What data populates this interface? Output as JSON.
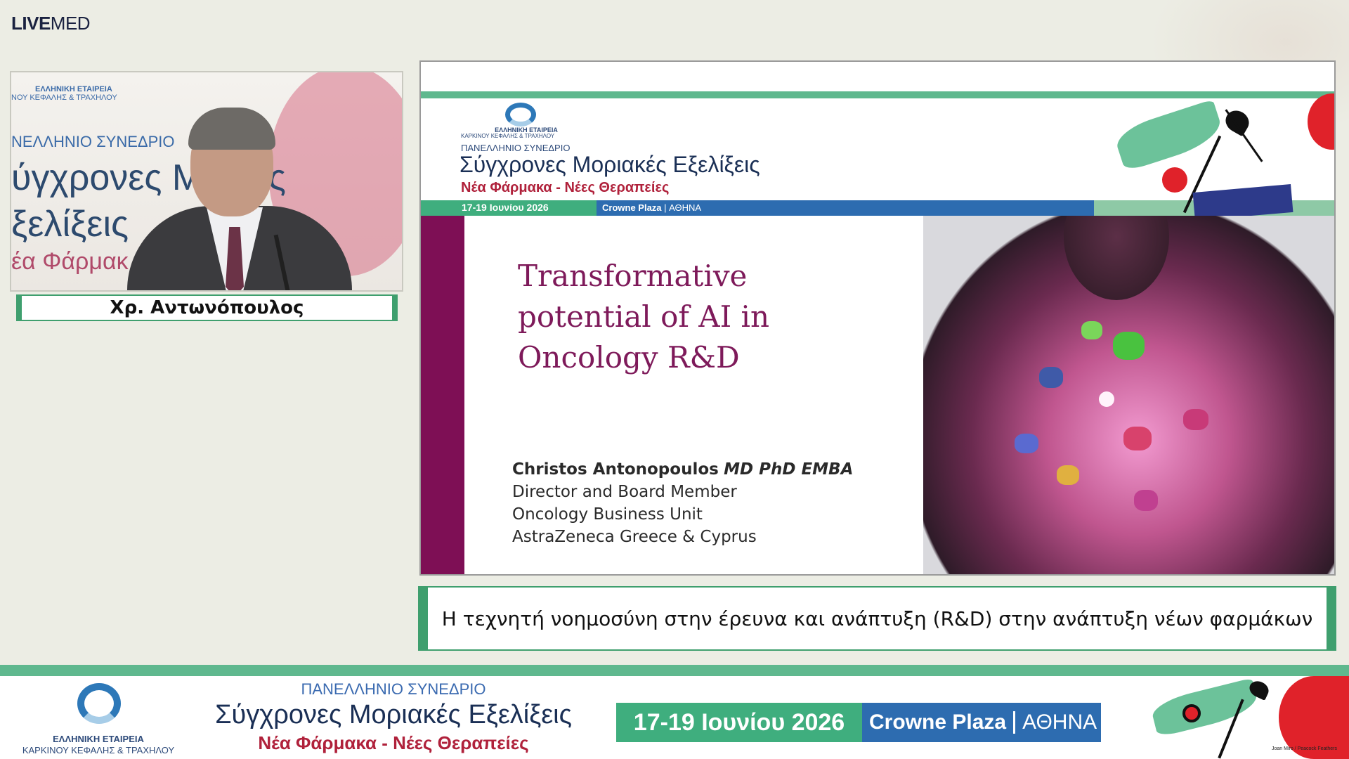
{
  "brand": {
    "part1": "LIVE",
    "part2": "MED"
  },
  "camera": {
    "org_line1": "ΕΛΛΗΝΙΚΗ ΕΤΑΙΡΕΙΑ",
    "org_line2": "ΝΟΥ ΚΕΦΑΛΗΣ & ΤΡΑΧΗΛΟΥ",
    "congress": "ΝΕΛΛΗΝΙΟ ΣΥΝΕΔΡΙΟ",
    "title_line1": "ύγχρονες Μ   ακές",
    "title_line2": "ξελίξεις",
    "subtitle": "έα Φάρμακ           ίες"
  },
  "speaker": {
    "name": "Χρ. Αντωνόπουλος"
  },
  "slide": {
    "org_line1": "ΕΛΛΗΝΙΚΗ ΕΤΑΙΡΕΙΑ",
    "org_line2": "ΚΑΡΚΙΝΟΥ ΚΕΦΑΛΗΣ & ΤΡΑΧΗΛΟΥ",
    "congress": "ΠΑΝΕΛΛΗΝΙΟ ΣΥΝΕΔΡΙΟ",
    "conference_title": "Σύγχρονες Μοριακές Εξελίξεις",
    "conference_subtitle": "Νέα Φάρμακα - Νέες Θεραπείες",
    "dates": "17-19 Ιουνίου 2026",
    "venue": "Crowne Plaza",
    "city": "ΑΘΗΝΑ",
    "title": "Transformative potential of AI in Oncology R&D",
    "presenter_name": "Christos Antonopoulos",
    "presenter_credentials": "MD PhD EMBA",
    "presenter_role": "Director and Board Member",
    "presenter_unit": "Oncology Business Unit",
    "presenter_company": "AstraZeneca Greece & Cyprus"
  },
  "caption": {
    "text": "Η τεχνητή νοημοσύνη στην έρευνα και ανάπτυξη (R&D) στην ανάπτυξη νέων φαρμάκων"
  },
  "footer": {
    "org_line1": "ΕΛΛΗΝΙΚΗ ΕΤΑΙΡΕΙΑ",
    "org_line2": "ΚΑΡΚΙΝΟΥ ΚΕΦΑΛΗΣ & ΤΡΑΧΗΛΟΥ",
    "congress": "ΠΑΝΕΛΛΗΝΙΟ ΣΥΝΕΔΡΙΟ",
    "title": "Σύγχρονες Μοριακές Εξελίξεις",
    "subtitle": "Νέα Φάρμακα - Νέες Θεραπείες",
    "dates": "17-19 Ιουνίου 2026",
    "venue": "Crowne Plaza",
    "city": "ΑΘΗΝΑ",
    "art_credit": "Joan Miro / Peacock Feathers"
  },
  "colors": {
    "accent_green": "#3f9f6e",
    "brand_blue": "#2d6cb0",
    "slide_purple": "#7e0f55",
    "subtitle_red": "#b0213b"
  }
}
